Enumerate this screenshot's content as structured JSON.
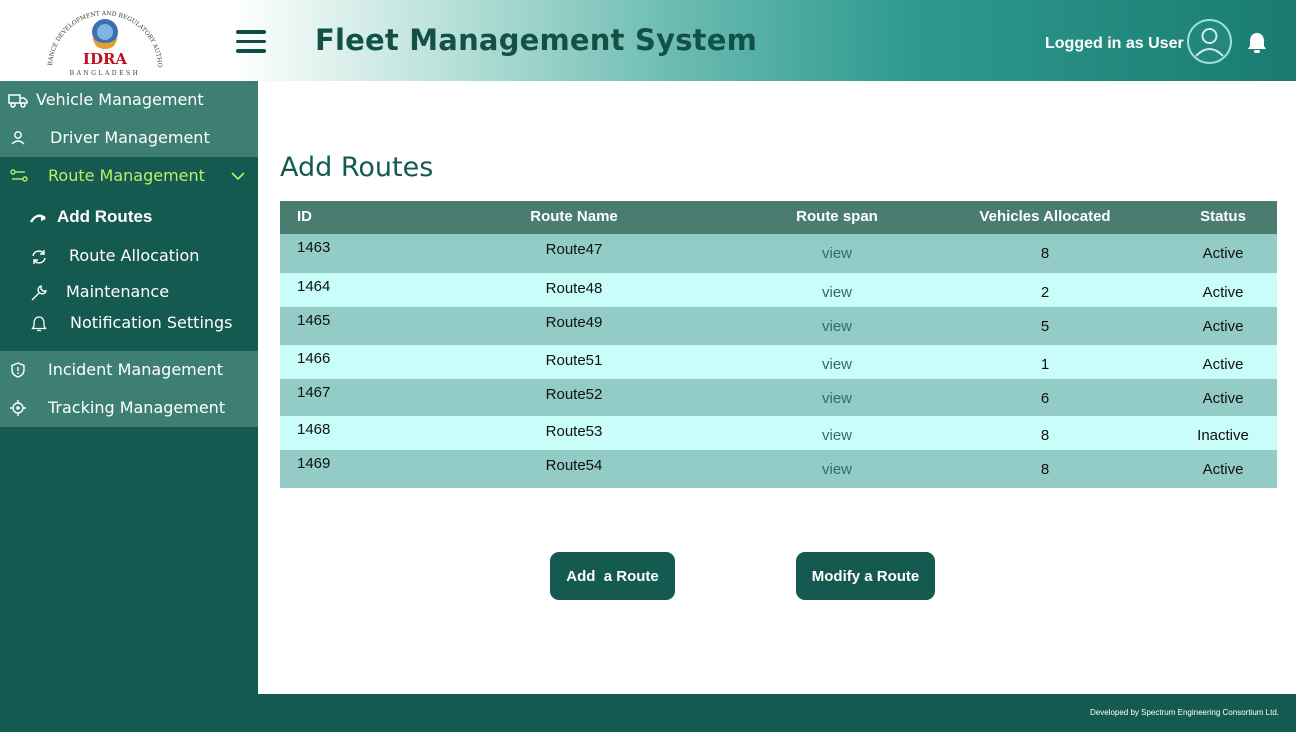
{
  "header": {
    "logo_top_text": "INSURANCE DEVELOPMENT AND REGULATORY AUTHORITY",
    "logo_main_text": "IDRA",
    "logo_country": "BANGLADESH",
    "app_title": "Fleet Management System",
    "user_label": "Logged in as User",
    "icons": [
      "menu-icon",
      "user-avatar-icon",
      "bell-icon"
    ]
  },
  "sidebar": {
    "items": [
      {
        "label": "Vehicle Management",
        "icon": "truck-icon"
      },
      {
        "label": "Driver Management",
        "icon": "person-icon"
      },
      {
        "label": "Route Management",
        "icon": "route-icon",
        "expanded": true
      },
      {
        "label": "Incident Management",
        "icon": "shield-icon"
      },
      {
        "label": "Tracking Management",
        "icon": "locate-icon"
      }
    ],
    "subitems": [
      {
        "label": "Add Routes",
        "icon": "redo-arrow-icon",
        "active": true
      },
      {
        "label": "Route Allocation",
        "icon": "refresh-icon"
      },
      {
        "label": "Maintenance",
        "icon": "wrench-icon"
      },
      {
        "label": "Notification Settings",
        "icon": "bell-icon"
      }
    ]
  },
  "main": {
    "title": "Add Routes",
    "table": {
      "headers": [
        "ID",
        "Route Name",
        "Route span",
        "Vehicles Allocated",
        "Status"
      ],
      "rows": [
        {
          "id": "1463",
          "name": "Route47",
          "span": "view",
          "vehicles": "8",
          "status": "Active"
        },
        {
          "id": "1464",
          "name": "Route48",
          "span": "view",
          "vehicles": "2",
          "status": "Active"
        },
        {
          "id": "1465",
          "name": "Route49",
          "span": "view",
          "vehicles": "5",
          "status": "Active"
        },
        {
          "id": "1466",
          "name": "Route51",
          "span": "view",
          "vehicles": "1",
          "status": "Active"
        },
        {
          "id": "1467",
          "name": "Route52",
          "span": "view",
          "vehicles": "6",
          "status": "Active"
        },
        {
          "id": "1468",
          "name": "Route53",
          "span": "view",
          "vehicles": "8",
          "status": "Inactive"
        },
        {
          "id": "1469",
          "name": "Route54",
          "span": "view",
          "vehicles": "8",
          "status": "Active"
        }
      ]
    },
    "buttons": {
      "add": "Add  a Route",
      "modify": "Modify a Route"
    }
  },
  "footer": {
    "text": "Developed by Spectrum Engineering Consortium Ltd."
  },
  "colors": {
    "primary": "#155a50",
    "sidebar_item": "#3d7f72",
    "active_green": "#b8f06a",
    "row_dark": "#93ccc6",
    "row_light": "#c8fdfa",
    "table_header": "#4a7d70"
  }
}
